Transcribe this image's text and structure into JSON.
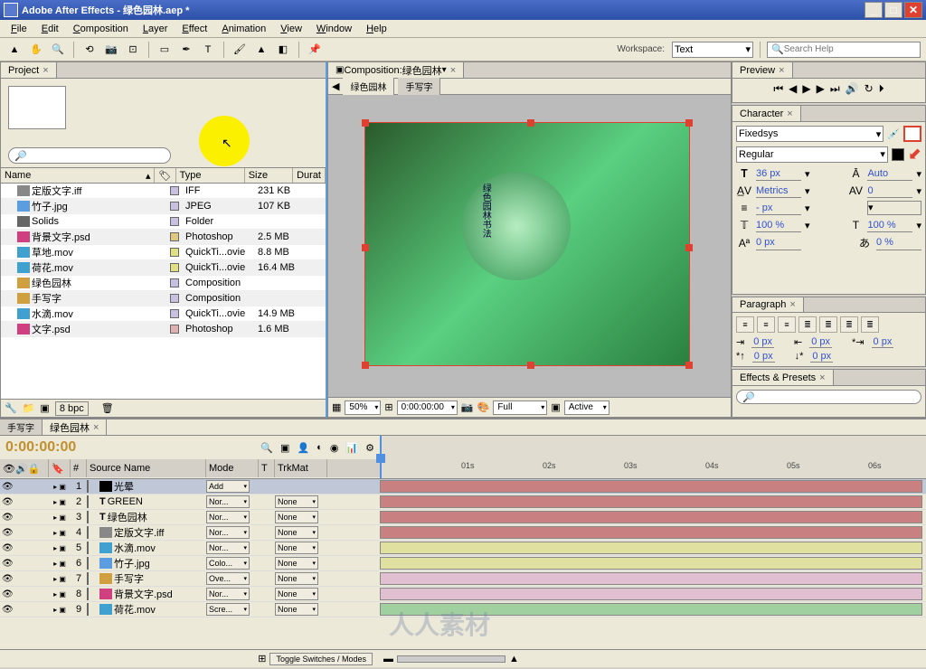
{
  "title": "Adobe After Effects - 绿色园林.aep *",
  "menu": [
    "File",
    "Edit",
    "Composition",
    "Layer",
    "Effect",
    "Animation",
    "View",
    "Window",
    "Help"
  ],
  "workspace": {
    "label": "Workspace:",
    "value": "Text"
  },
  "search_help": "Search Help",
  "project": {
    "tab": "Project",
    "cols": {
      "name": "Name",
      "type": "Type",
      "size": "Size",
      "dur": "Durat"
    },
    "bpc": "8 bpc",
    "items": [
      {
        "name": "定版文字.iff",
        "type": "IFF",
        "size": "231 KB",
        "color": "#c8c0e0",
        "icon": "#888"
      },
      {
        "name": "竹子.jpg",
        "type": "JPEG",
        "size": "107 KB",
        "color": "#c8c0e0",
        "icon": "#5a9de0"
      },
      {
        "name": "Solids",
        "type": "Folder",
        "size": "",
        "color": "#c8c0e0",
        "icon": "#666"
      },
      {
        "name": "背景文字.psd",
        "type": "Photoshop",
        "size": "2.5 MB",
        "color": "#e0c880",
        "icon": "#d04080"
      },
      {
        "name": "草地.mov",
        "type": "QuickTi...ovie",
        "size": "8.8 MB",
        "color": "#e0e080",
        "icon": "#40a0d0"
      },
      {
        "name": "荷花.mov",
        "type": "QuickTi...ovie",
        "size": "16.4 MB",
        "color": "#e0e080",
        "icon": "#40a0d0"
      },
      {
        "name": "绿色园林",
        "type": "Composition",
        "size": "",
        "color": "#c8c0e0",
        "icon": "#d0a040"
      },
      {
        "name": "手写字",
        "type": "Composition",
        "size": "",
        "color": "#c8c0e0",
        "icon": "#d0a040"
      },
      {
        "name": "水滴.mov",
        "type": "QuickTi...ovie",
        "size": "14.9 MB",
        "color": "#c8c0e0",
        "icon": "#40a0d0"
      },
      {
        "name": "文字.psd",
        "type": "Photoshop",
        "size": "1.6 MB",
        "color": "#e0b0b0",
        "icon": "#d04080"
      }
    ]
  },
  "comp": {
    "label": "Composition:",
    "name": "绿色园林",
    "tabs": [
      "绿色园林",
      "手写字"
    ],
    "zoom": "50%",
    "time": "0:00:00:00",
    "view": "Full",
    "active": "Active"
  },
  "preview": {
    "tab": "Preview"
  },
  "character": {
    "tab": "Character",
    "font": "Fixedsys",
    "style": "Regular",
    "size": "36 px",
    "leading": "Auto",
    "kerning": "Metrics",
    "tracking": "0",
    "stroke": "- px",
    "vscale": "100 %",
    "hscale": "100 %",
    "baseline": "0 px",
    "tsume": "0 %"
  },
  "paragraph": {
    "tab": "Paragraph",
    "indents": [
      "0 px",
      "0 px",
      "0 px",
      "0 px",
      "0 px"
    ]
  },
  "effects": {
    "tab": "Effects & Presets"
  },
  "timeline": {
    "tabs": [
      "手写字",
      "绿色园林"
    ],
    "time": "0:00:00:00",
    "cols": {
      "num": "#",
      "src": "Source Name",
      "mode": "Mode",
      "t": "T",
      "trk": "TrkMat"
    },
    "toggle": "Toggle Switches / Modes",
    "ticks": [
      "01s",
      "02s",
      "03s",
      "04s",
      "05s",
      "06s"
    ],
    "layers": [
      {
        "n": 1,
        "c": "#c04040",
        "name": "光晕",
        "mode": "Add",
        "trk": "",
        "bar": "#c88080",
        "icon": "#000"
      },
      {
        "n": 2,
        "c": "#c04040",
        "name": "GREEN",
        "mode": "Nor...",
        "trk": "None",
        "bar": "#c88080",
        "icon": "T"
      },
      {
        "n": 3,
        "c": "#c04040",
        "name": "绿色园林",
        "mode": "Nor...",
        "trk": "None",
        "bar": "#c88080",
        "icon": "T"
      },
      {
        "n": 4,
        "c": "#c04040",
        "name": "定版文字.iff",
        "mode": "Nor...",
        "trk": "None",
        "bar": "#c88080",
        "icon": "#888"
      },
      {
        "n": 5,
        "c": "#e0e080",
        "name": "水滴.mov",
        "mode": "Nor...",
        "trk": "None",
        "bar": "#e0e0a0",
        "icon": "#40a0d0"
      },
      {
        "n": 6,
        "c": "#e0e080",
        "name": "竹子.jpg",
        "mode": "Colo...",
        "trk": "None",
        "bar": "#e0e0a0",
        "icon": "#5a9de0"
      },
      {
        "n": 7,
        "c": "#e0a0c0",
        "name": "手写字",
        "mode": "Ove...",
        "trk": "None",
        "bar": "#e0c0d0",
        "icon": "#d0a040"
      },
      {
        "n": 8,
        "c": "#e0a0c0",
        "name": "背景文字.psd",
        "mode": "Nor...",
        "trk": "None",
        "bar": "#e0c0d0",
        "icon": "#d04080"
      },
      {
        "n": 9,
        "c": "#80c080",
        "name": "荷花.mov",
        "mode": "Scre...",
        "trk": "None",
        "bar": "#a0d0a0",
        "icon": "#40a0d0"
      }
    ]
  },
  "watermark": "人人素材"
}
